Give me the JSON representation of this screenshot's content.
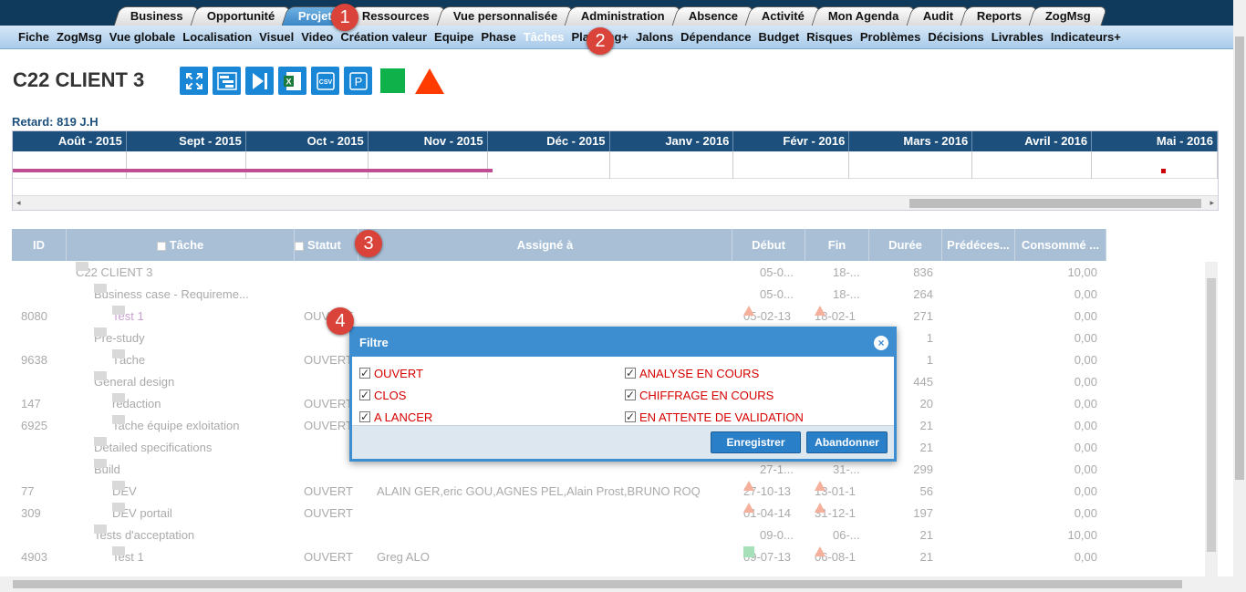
{
  "top_tabs": [
    {
      "label": "Business"
    },
    {
      "label": "Opportunité"
    },
    {
      "label": "Projets",
      "active": true
    },
    {
      "label": "Ressources"
    },
    {
      "label": "Vue personnalisée"
    },
    {
      "label": "Administration"
    },
    {
      "label": "Absence"
    },
    {
      "label": "Activité"
    },
    {
      "label": "Mon Agenda"
    },
    {
      "label": "Audit"
    },
    {
      "label": "Reports"
    },
    {
      "label": "ZogMsg"
    }
  ],
  "sub_nav": [
    {
      "label": "Fiche"
    },
    {
      "label": "ZogMsg"
    },
    {
      "label": "Vue globale"
    },
    {
      "label": "Localisation"
    },
    {
      "label": "Visuel"
    },
    {
      "label": "Video"
    },
    {
      "label": "Création valeur"
    },
    {
      "label": "Equipe"
    },
    {
      "label": "Phase"
    },
    {
      "label": "Tâches",
      "active": true
    },
    {
      "label": "Planning+"
    },
    {
      "label": "Jalons"
    },
    {
      "label": "Dépendance"
    },
    {
      "label": "Budget"
    },
    {
      "label": "Risques"
    },
    {
      "label": "Problèmes"
    },
    {
      "label": "Décisions"
    },
    {
      "label": "Livrables"
    },
    {
      "label": "Indicateurs+"
    }
  ],
  "badges": [
    "1",
    "2",
    "3",
    "4"
  ],
  "project": {
    "title": "C22 CLIENT 3",
    "retard": "Retard: 819 J.H"
  },
  "toolbar": {
    "icons": [
      "expand-icon",
      "gantt-icon",
      "skip-next-icon",
      "excel-icon",
      "csv-icon",
      "p-icon"
    ],
    "status_color": "#0fb14a",
    "alert_color": "#ff3b00",
    "excel_text": "X",
    "csv_text": "CSV",
    "p_text": "P"
  },
  "gantt": {
    "months": [
      "Août - 2015",
      "Sept - 2015",
      "Oct - 2015",
      "Nov - 2015",
      "Déc - 2015",
      "Janv - 2016",
      "Févr - 2016",
      "Mars - 2016",
      "Avril - 2016",
      "Mai - 2016"
    ],
    "bar_color": "#c04c94",
    "scroll_left": "◂",
    "scroll_right": "▸"
  },
  "table": {
    "columns": [
      "ID",
      "Tâche",
      "Statut",
      "Assigné à",
      "Début",
      "Fin",
      "Durée",
      "Prédéces...",
      "Consommé ..."
    ],
    "rows": [
      {
        "id": "",
        "task": "C22 CLIENT 3",
        "level": 0,
        "statut": "",
        "assign": "",
        "debut": "05-0...",
        "fin": "18-...",
        "duree": "836",
        "conso": "10,00",
        "d_ic": "",
        "f_ic": ""
      },
      {
        "id": "",
        "task": "Business case - Requireme...",
        "level": 1,
        "statut": "",
        "assign": "",
        "debut": "05-0...",
        "fin": "18-...",
        "duree": "264",
        "conso": "0,00",
        "d_ic": "",
        "f_ic": ""
      },
      {
        "id": "8080",
        "task": "Test 1",
        "level": 2,
        "statut": "OUVERT",
        "assign": "",
        "debut": "05-02-13",
        "fin": "18-02-1",
        "duree": "271",
        "conso": "0,00",
        "d_ic": "tri",
        "f_ic": "tri",
        "link": true
      },
      {
        "id": "",
        "task": "Pre-study",
        "level": 1,
        "statut": "",
        "assign": "",
        "debut": "",
        "fin": "",
        "duree": "1",
        "conso": "0,00",
        "d_ic": "",
        "f_ic": ""
      },
      {
        "id": "9638",
        "task": "Tâche",
        "level": 2,
        "statut": "OUVERT",
        "assign": "",
        "debut": "",
        "fin": "",
        "duree": "1",
        "conso": "0,00",
        "d_ic": "",
        "f_ic": ""
      },
      {
        "id": "",
        "task": "General design",
        "level": 1,
        "statut": "",
        "assign": "",
        "debut": "",
        "fin": "",
        "duree": "445",
        "conso": "0,00",
        "d_ic": "",
        "f_ic": ""
      },
      {
        "id": "147",
        "task": "rédaction",
        "level": 2,
        "statut": "OUVERT",
        "assign": "",
        "debut": "",
        "fin": "",
        "duree": "20",
        "conso": "0,00",
        "d_ic": "",
        "f_ic": ""
      },
      {
        "id": "6925",
        "task": "Tache équipe exloitation",
        "level": 2,
        "statut": "OUVERT",
        "assign": "",
        "debut": "",
        "fin": "",
        "duree": "21",
        "conso": "0,00",
        "d_ic": "",
        "f_ic": ""
      },
      {
        "id": "",
        "task": "Detailed specifications",
        "level": 1,
        "statut": "",
        "assign": "",
        "debut": "",
        "fin": "",
        "duree": "21",
        "conso": "0,00",
        "d_ic": "",
        "f_ic": ""
      },
      {
        "id": "",
        "task": "Build",
        "level": 1,
        "statut": "",
        "assign": "",
        "debut": "27-1...",
        "fin": "31-...",
        "duree": "299",
        "conso": "0,00",
        "d_ic": "",
        "f_ic": ""
      },
      {
        "id": "77",
        "task": "DEV",
        "level": 2,
        "statut": "OUVERT",
        "assign": "ALAIN GER,eric GOU,AGNES PEL,Alain Prost,BRUNO ROQ",
        "debut": "27-10-13",
        "fin": "13-01-1",
        "duree": "56",
        "conso": "0,00",
        "d_ic": "tri",
        "f_ic": "tri"
      },
      {
        "id": "309",
        "task": "DEV portail",
        "level": 2,
        "statut": "OUVERT",
        "assign": "",
        "debut": "01-04-14",
        "fin": "31-12-1",
        "duree": "197",
        "conso": "0,00",
        "d_ic": "tri",
        "f_ic": "tri"
      },
      {
        "id": "",
        "task": "Tests d'acceptation",
        "level": 1,
        "statut": "",
        "assign": "",
        "debut": "09-0...",
        "fin": "06-...",
        "duree": "21",
        "conso": "10,00",
        "d_ic": "",
        "f_ic": ""
      },
      {
        "id": "4903",
        "task": "Test 1",
        "level": 2,
        "statut": "OUVERT",
        "assign": "Greg ALO",
        "debut": "09-07-13",
        "fin": "06-08-1",
        "duree": "21",
        "conso": "0,00",
        "d_ic": "sq",
        "f_ic": "tri"
      }
    ]
  },
  "filter_dialog": {
    "title": "Filtre",
    "close_glyph": "×",
    "options": [
      {
        "label": "OUVERT",
        "checked": true
      },
      {
        "label": "ANALYSE EN COURS",
        "checked": true
      },
      {
        "label": "CLOS",
        "checked": true
      },
      {
        "label": "CHIFFRAGE EN COURS",
        "checked": true
      },
      {
        "label": "A LANCER",
        "checked": true
      },
      {
        "label": "EN ATTENTE DE VALIDATION",
        "checked": true
      }
    ],
    "save_label": "Enregistrer",
    "cancel_label": "Abandonner"
  }
}
